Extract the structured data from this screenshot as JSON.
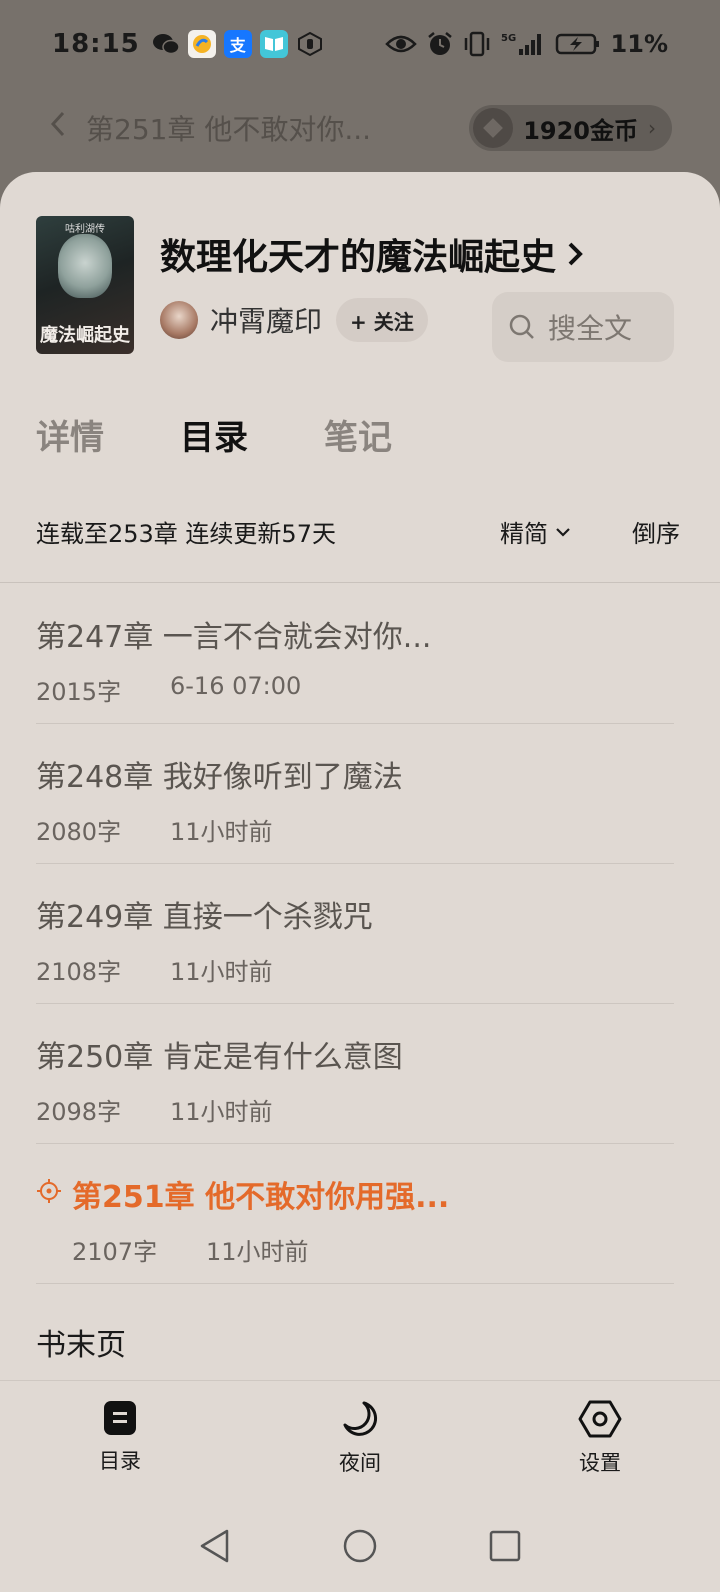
{
  "status": {
    "time": "18:15",
    "battery": "11%",
    "apps": [
      {
        "name": "wechat-icon",
        "glyph": "",
        "color": "#77716b"
      },
      {
        "name": "pay-app-icon",
        "glyph": "",
        "color": "#f4f1ec"
      },
      {
        "name": "alipay-icon",
        "glyph": "支",
        "color": "#1677ff"
      },
      {
        "name": "reader-app-icon",
        "glyph": "",
        "color": "#43c6d8"
      }
    ]
  },
  "reader": {
    "chapter_title": "第251章 他不敢对你...",
    "coins": "1920金币"
  },
  "book": {
    "cover_publisher": "咕利湖传",
    "cover_title": "魔法崛起史",
    "title": "数理化天才的魔法崛起史",
    "author": "冲霄魔印",
    "follow_label": "+ 关注",
    "search_label": "搜全文"
  },
  "tabs": [
    {
      "label": "详情",
      "active": false
    },
    {
      "label": "目录",
      "active": true
    },
    {
      "label": "笔记",
      "active": false
    }
  ],
  "catalog": {
    "summary": "连载至253章 连续更新57天",
    "version": "精简",
    "order": "倒序",
    "chapters": [
      {
        "title": "第247章 一言不合就会对你...",
        "words": "2015字",
        "time": "6-16 07:00"
      },
      {
        "title": "第248章 我好像听到了魔法",
        "words": "2080字",
        "time": "11小时前"
      },
      {
        "title": "第249章 直接一个杀戮咒",
        "words": "2108字",
        "time": "11小时前"
      },
      {
        "title": "第250章 肯定是有什么意图",
        "words": "2098字",
        "time": "11小时前"
      },
      {
        "title": "第251章 他不敢对你用强...",
        "words": "2107字",
        "time": "11小时前",
        "current": true
      }
    ],
    "book_end": "书末页"
  },
  "toolbar": {
    "catalog": "目录",
    "night": "夜间",
    "settings": "设置"
  },
  "colors": {
    "accent": "#e46a2a",
    "sheet_bg": "#e0d9d3"
  }
}
